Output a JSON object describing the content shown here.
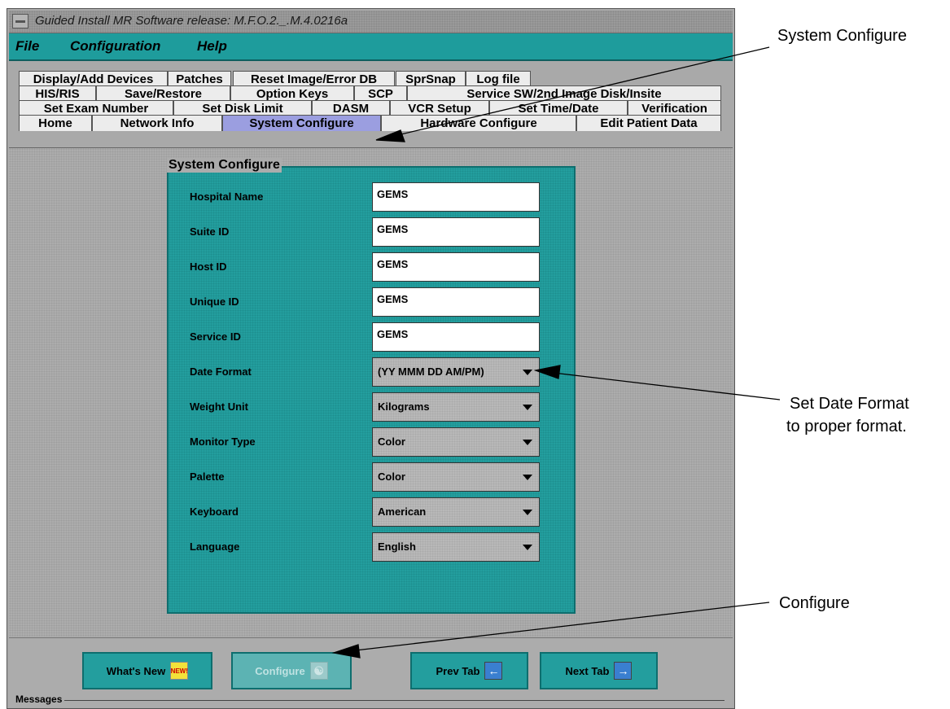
{
  "window": {
    "title": "Guided Install  MR Software release: M.F.O.2._.M.4.0216a"
  },
  "menubar": {
    "items": [
      "File",
      "Configuration",
      "Help"
    ]
  },
  "tabs": {
    "row1": [
      "Display/Add Devices",
      "Patches",
      "Reset Image/Error DB",
      "SprSnap",
      "Log file"
    ],
    "row2": [
      "HIS/RIS",
      "Save/Restore",
      "Option Keys",
      "SCP",
      "Service SW/2nd Image Disk/Insite"
    ],
    "row3": [
      "Set Exam Number",
      "Set Disk Limit",
      "DASM",
      "VCR Setup",
      "Set Time/Date",
      "Verification"
    ],
    "row4": [
      "Home",
      "Network Info",
      "System Configure",
      "Hardware Configure",
      "Edit Patient Data"
    ],
    "active": "System Configure"
  },
  "panel": {
    "title": "System Configure",
    "fields": [
      {
        "label": "Hospital Name",
        "value": "GEMS"
      },
      {
        "label": "Suite ID",
        "value": "GEMS"
      },
      {
        "label": "Host ID",
        "value": "GEMS"
      },
      {
        "label": "Unique ID",
        "value": "GEMS"
      },
      {
        "label": "Service ID",
        "value": "GEMS"
      }
    ],
    "dropdowns": [
      {
        "label": "Date Format",
        "value": "(YY MMM DD AM/PM)"
      },
      {
        "label": "Weight Unit",
        "value": "Kilograms"
      },
      {
        "label": "Monitor Type",
        "value": "Color"
      },
      {
        "label": "Palette",
        "value": "Color"
      },
      {
        "label": "Keyboard",
        "value": "American"
      },
      {
        "label": "Language",
        "value": "English"
      }
    ]
  },
  "buttons": {
    "whats_new": "What's New",
    "configure": "Configure",
    "prev_tab": "Prev Tab",
    "next_tab": "Next Tab",
    "new_badge": "NEW!"
  },
  "messages_label": "Messages",
  "callouts": {
    "system_configure": "System Configure",
    "date_format_line1": "Set Date Format",
    "date_format_line2": "to proper format.",
    "configure": "Configure"
  },
  "colors": {
    "teal": "#239e9e",
    "active_tab": "#9b9ee0",
    "window_gray": "#a9a9a9"
  }
}
